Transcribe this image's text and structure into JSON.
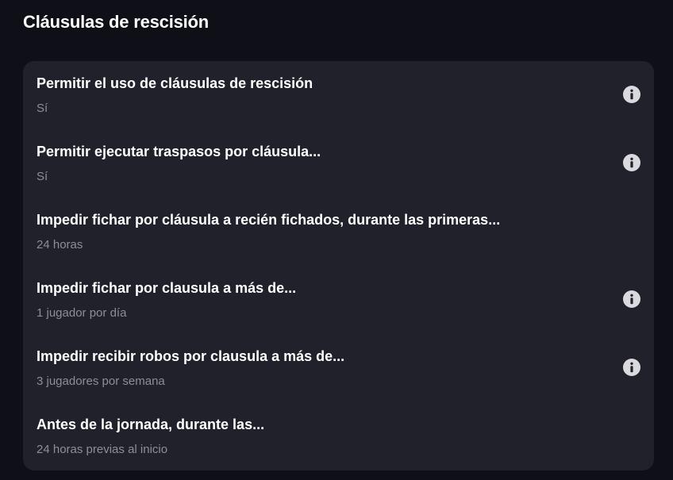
{
  "section": {
    "title": "Cláusulas de rescisión"
  },
  "rows": [
    {
      "title": "Permitir el uso de cláusulas de rescisión",
      "value": "Sí",
      "info": true
    },
    {
      "title": "Permitir ejecutar traspasos por cláusula...",
      "value": "Sí",
      "info": true
    },
    {
      "title": "Impedir fichar por cláusula a recién fichados, durante las primeras...",
      "value": "24 horas",
      "info": false
    },
    {
      "title": "Impedir fichar por clausula a más de...",
      "value": "1 jugador por día",
      "info": true
    },
    {
      "title": "Impedir recibir robos por clausula a más de...",
      "value": "3 jugadores por semana",
      "info": true
    },
    {
      "title": "Antes de la jornada, durante las...",
      "value": "24 horas previas al inicio",
      "info": false
    }
  ],
  "colors": {
    "background": "#0f0f17",
    "card": "#20212b",
    "title": "#ffffff",
    "value": "#8d8e97",
    "info_icon": "#d9d9de"
  },
  "icons": {
    "info": "info-circle-icon"
  }
}
